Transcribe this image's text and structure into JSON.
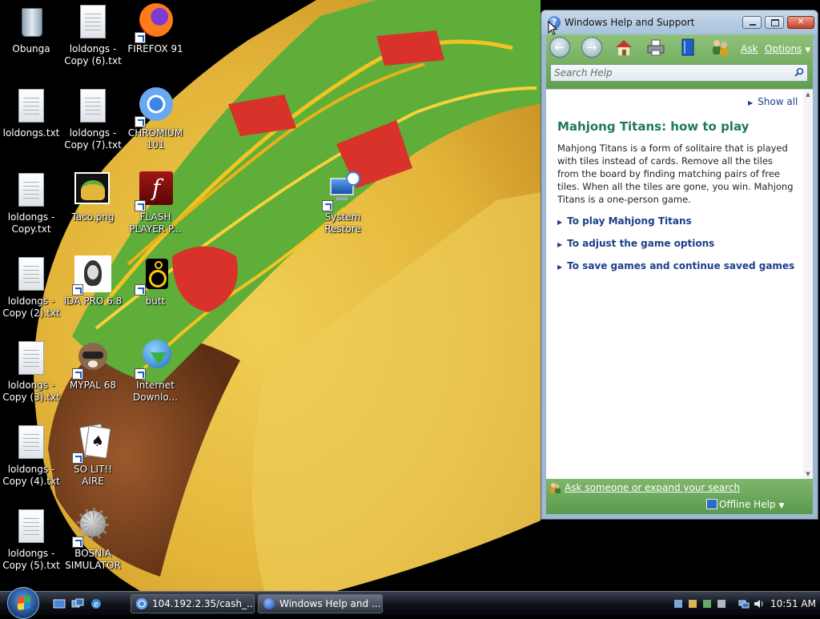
{
  "desktop": {
    "icons": [
      {
        "id": "recycle-bin",
        "label": "Obunga",
        "icon": "recycle-bin-icon"
      },
      {
        "id": "loldongs-copy-6",
        "label": "loldongs - Copy (6).txt",
        "icon": "text-file-icon"
      },
      {
        "id": "firefox",
        "label": "FIREFOX 91",
        "icon": "firefox-icon"
      },
      {
        "id": "loldongs",
        "label": "loldongs.txt",
        "icon": "text-file-icon"
      },
      {
        "id": "loldongs-copy-7",
        "label": "loldongs - Copy (7).txt",
        "icon": "text-file-icon"
      },
      {
        "id": "chromium",
        "label": "CHROMIUM 101",
        "icon": "chromium-icon"
      },
      {
        "id": "loldongs-copy",
        "label": "loldongs - Copy.txt",
        "icon": "text-file-icon"
      },
      {
        "id": "taco-png",
        "label": "Taco.png",
        "icon": "image-file-icon"
      },
      {
        "id": "flash-player",
        "label": "FLASH PLAYER P...",
        "icon": "flash-icon"
      },
      {
        "id": "system-restore",
        "label": "System Restore",
        "icon": "system-restore-icon"
      },
      {
        "id": "loldongs-copy-2",
        "label": "loldongs - Copy (2).txt",
        "icon": "text-file-icon"
      },
      {
        "id": "ida-pro",
        "label": "IDA PRO 6.8",
        "icon": "ida-pro-icon"
      },
      {
        "id": "butt",
        "label": "butt",
        "icon": "butt-icon"
      },
      {
        "id": "loldongs-copy-3",
        "label": "loldongs - Copy (3).txt",
        "icon": "text-file-icon"
      },
      {
        "id": "mypal",
        "label": "MYPAL 68",
        "icon": "mypal-icon"
      },
      {
        "id": "internet-download",
        "label": "Internet Downlo...",
        "icon": "internet-download-manager-icon"
      },
      {
        "id": "loldongs-copy-4",
        "label": "loldongs - Copy (4).txt",
        "icon": "text-file-icon"
      },
      {
        "id": "solitaire",
        "label": "SO LIT!! AIRE",
        "icon": "solitaire-icon"
      },
      {
        "id": "loldongs-copy-5",
        "label": "loldongs - Copy (5).txt",
        "icon": "text-file-icon"
      },
      {
        "id": "bosnia",
        "label": "BOSNIA SIMULATOR",
        "icon": "bosnia-simulator-icon"
      }
    ]
  },
  "help_window": {
    "title": "Windows Help and Support",
    "toolbar": {
      "ask_label": "Ask",
      "options_label": "Options",
      "search_placeholder": "Search Help"
    },
    "content": {
      "show_all": "Show all",
      "article_title": "Mahjong Titans: how to play",
      "article_body": "Mahjong Titans is a form of solitaire that is played with tiles instead of cards. Remove all the tiles from the board by finding matching pairs of free tiles. When all the tiles are gone, you win. Mahjong Titans is a one-person game.",
      "topics": [
        "To play Mahjong Titans",
        "To adjust the game options",
        "To save games and continue saved games"
      ]
    },
    "statusbar": {
      "ask_someone": "Ask someone or expand your search",
      "offline_help": "Offline Help"
    }
  },
  "taskbar": {
    "buttons": [
      {
        "label": "104.192.2.35/cash_...",
        "icon": "chromium-icon"
      },
      {
        "label": "Windows Help and ...",
        "icon": "help-icon"
      }
    ],
    "clock": "10:51 AM"
  },
  "colors": {
    "help_title_green": "#1e7a52",
    "help_link_blue": "#1b3f8a",
    "help_toolbar_green": "#6aa85a"
  }
}
